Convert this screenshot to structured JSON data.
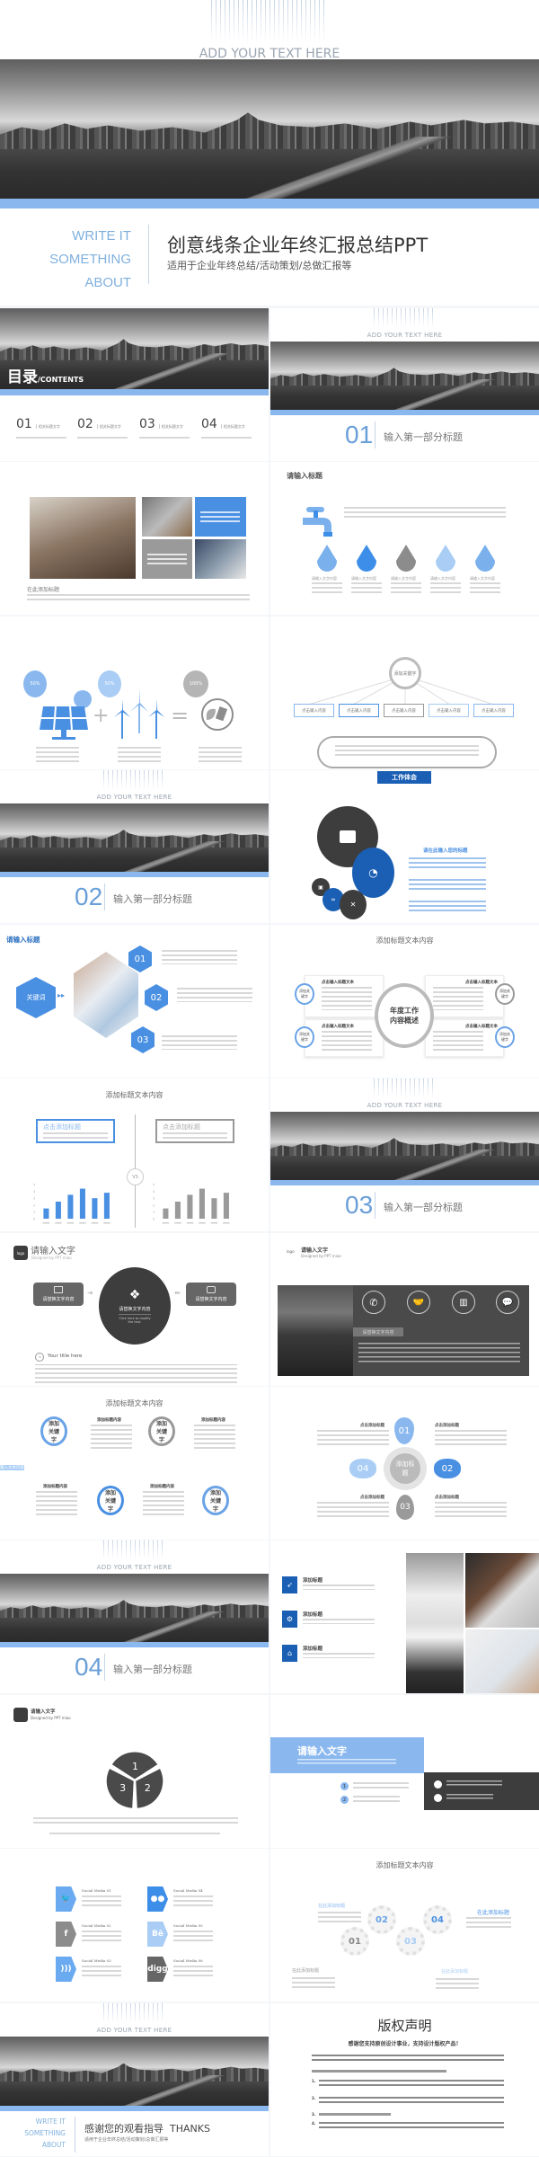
{
  "hero": {
    "top_text": "ADD YOUR TEXT HERE",
    "side_lines": [
      "WRITE IT",
      "SOMETHING",
      "ABOUT"
    ],
    "title": "创意线条企业年终汇报总结PPT",
    "subtitle": "适用于企业年终总结/活动策划/总做汇报等"
  },
  "common": {
    "add_text": "ADD YOUR TEXT HERE",
    "section_title": "输入第一部分标题",
    "section_numbers": [
      "01",
      "02",
      "03",
      "04"
    ],
    "logo": "logo",
    "designed_by": "Designed by PPT miao",
    "enter_text": "请输入文字",
    "add_title_content": "添加标题文本内容"
  },
  "contents": {
    "title_big": "目录",
    "title_small": "/CONTENTS",
    "items": [
      {
        "num": "01",
        "label": "相关标题文字"
      },
      {
        "num": "02",
        "label": "相关标题文字"
      },
      {
        "num": "03",
        "label": "相关标题文字"
      },
      {
        "num": "04",
        "label": "相关标题文字"
      }
    ]
  },
  "collage": {
    "caption": "在此添加标题"
  },
  "drops": {
    "title": "请输入标题",
    "colors": [
      "#7ab0ec",
      "#3d8ee8",
      "#8c8c8c",
      "#a9cdf5",
      "#7ab0ec"
    ],
    "labels": [
      "请输入文字内容",
      "请输入文字内容",
      "请输入文字内容",
      "请输入文字内容",
      "请输入文字内容"
    ]
  },
  "energy": {
    "pcts": [
      "50%",
      "50%",
      "100%"
    ],
    "plus": "+",
    "equals": "="
  },
  "tree": {
    "root": "添加关键字",
    "boxes": [
      "点击输入内容",
      "点击输入内容",
      "点击输入内容",
      "点击输入内容",
      "点击输入内容"
    ]
  },
  "work": {
    "header": "工作体会",
    "title": "请在此输入您的标题"
  },
  "hex": {
    "title": "请输入标题",
    "keyword": "关键词",
    "nums": [
      "01",
      "02",
      "03"
    ]
  },
  "annual": {
    "center": "年度工作内容概述",
    "card_title": "点击输入标题文本",
    "badge": "添加关键字"
  },
  "compare": {
    "box_title": "点击添加标题",
    "vs": "VS"
  },
  "chart_data": [
    {
      "type": "bar",
      "color": "#4a90e2",
      "ylim": [
        0,
        5
      ],
      "yticks": [
        0,
        1,
        2,
        3,
        4,
        5
      ],
      "values": [
        1.5,
        2.5,
        3.5,
        4.4,
        3.0,
        3.8
      ],
      "grid": false
    },
    {
      "type": "bar",
      "color": "#9a9a9a",
      "ylim": [
        0,
        5
      ],
      "yticks": [
        0,
        1,
        2,
        3,
        4,
        5
      ],
      "values": [
        1.5,
        2.5,
        3.5,
        4.4,
        3.0,
        3.8
      ],
      "grid": false
    }
  ],
  "flow": {
    "node_text": "请替换文字内容",
    "center_sub": "Click here to modify the text.",
    "your_title": "Your title here"
  },
  "dark_panel": {
    "label": "请替换文字内容",
    "icons": [
      "phone-icon",
      "handshake-icon",
      "chart-icon",
      "chat-icon"
    ]
  },
  "timeline": {
    "keyword": "添加关键字",
    "bar_labels": [
      "输入文本内容",
      "输入文本内容",
      "输入文本内容",
      "输入文本内容"
    ],
    "item_title": "添加标题内容"
  },
  "flower": {
    "center": "添加标题",
    "nums": [
      "01",
      "02",
      "03",
      "04"
    ],
    "label": "点击添加标题"
  },
  "icon_list": {
    "items": [
      "添加标题",
      "添加标题",
      "添加标题"
    ]
  },
  "pie": {
    "segments": [
      "1",
      "2",
      "3"
    ]
  },
  "blue_box": {
    "list_nums": [
      "1",
      "2"
    ]
  },
  "social": {
    "items": [
      {
        "name": "Social Media 01",
        "icon": "twitter-icon",
        "color": "#6aaaf0"
      },
      {
        "name": "Social Media 04",
        "icon": "flickr-icon",
        "color": "#3d8ee8"
      },
      {
        "name": "Social Media 02",
        "icon": "facebook-icon",
        "color": "#8c8c8c"
      },
      {
        "name": "Social Media 05",
        "icon": "behance-icon",
        "color": "#a9cdf5"
      },
      {
        "name": "Social Media 03",
        "icon": "rss-icon",
        "color": "#6aaaf0"
      },
      {
        "name": "Social Media 06",
        "icon": "digg-icon",
        "color": "#666666"
      }
    ]
  },
  "gears": {
    "nums": [
      "01",
      "02",
      "03",
      "04"
    ],
    "label": "在此添加标题"
  },
  "thanks": {
    "title": "感谢您的观看指导",
    "title_en": "THANKS",
    "subtitle": "适用于企业年终总结/活动策划/总做汇报等"
  },
  "copyright": {
    "title": "版权声明",
    "subtitle": "感谢您支持原创设计事业，支持设计版权产品！",
    "numbers": [
      "1.",
      "2.",
      "3.",
      "4."
    ]
  },
  "colors": {
    "accent": "#8ab8ee",
    "blue": "#4a90e2",
    "dark_blue": "#1a5fb4",
    "dark": "#3d3d3d"
  }
}
